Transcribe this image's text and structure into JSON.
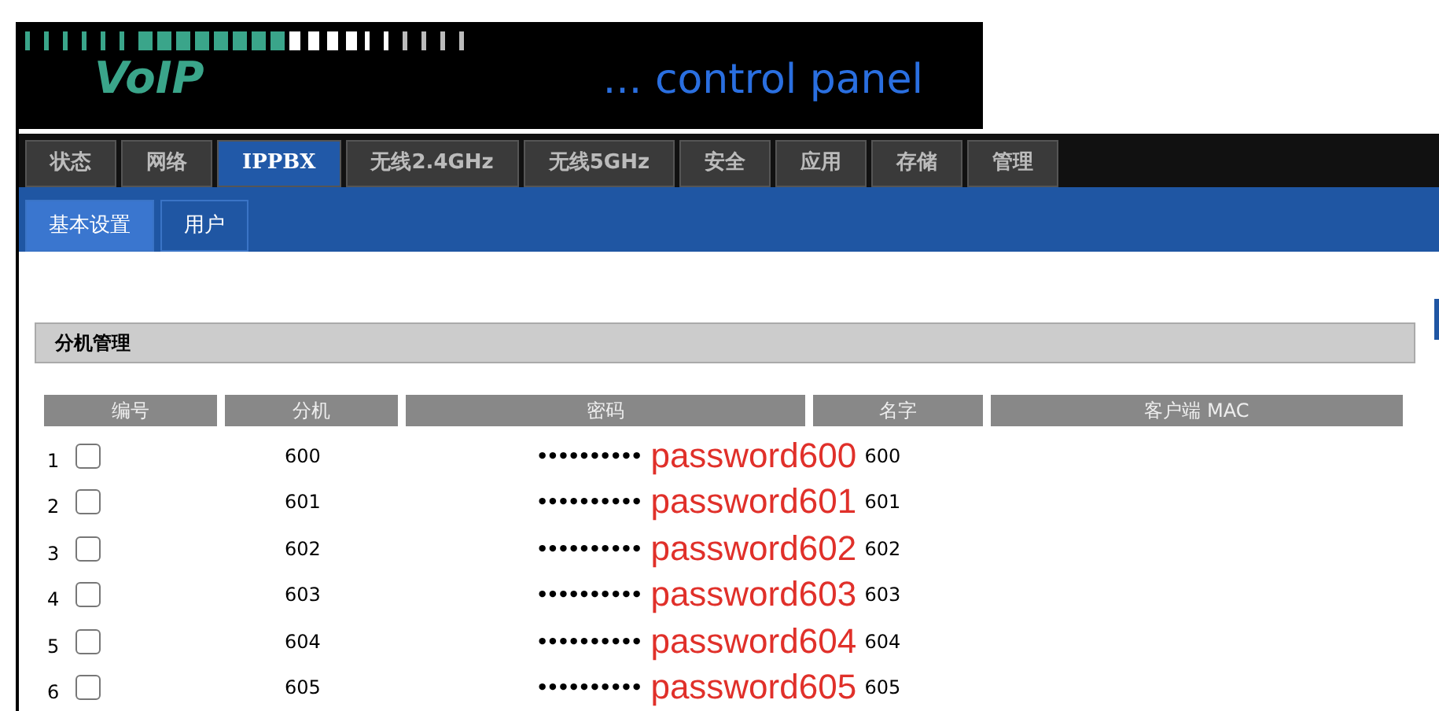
{
  "header": {
    "logo": "VoIP",
    "tagline": "... control panel"
  },
  "tabs": [
    {
      "label": "状态",
      "selected": false
    },
    {
      "label": "网络",
      "selected": false
    },
    {
      "label": "IPPBX",
      "selected": true
    },
    {
      "label": "无线2.4GHz",
      "selected": false
    },
    {
      "label": "无线5GHz",
      "selected": false
    },
    {
      "label": "安全",
      "selected": false
    },
    {
      "label": "应用",
      "selected": false
    },
    {
      "label": "存储",
      "selected": false
    },
    {
      "label": "管理",
      "selected": false
    }
  ],
  "subtabs": [
    {
      "label": "基本设置",
      "selected": true
    },
    {
      "label": "用户",
      "selected": false
    }
  ],
  "section": {
    "title": "分机管理"
  },
  "table": {
    "columns": [
      "编号",
      "分机",
      "密码",
      "名字",
      "客户端 MAC"
    ],
    "rows": [
      {
        "index": "1",
        "checked": false,
        "extension": "600",
        "password": "••••••••••",
        "note": "password600",
        "name": "600"
      },
      {
        "index": "2",
        "checked": false,
        "extension": "601",
        "password": "••••••••••",
        "note": "password601",
        "name": "601"
      },
      {
        "index": "3",
        "checked": false,
        "extension": "602",
        "password": "••••••••••",
        "note": "password602",
        "name": "602"
      },
      {
        "index": "4",
        "checked": false,
        "extension": "603",
        "password": "••••••••••",
        "note": "password603",
        "name": "603"
      },
      {
        "index": "5",
        "checked": false,
        "extension": "604",
        "password": "••••••••••",
        "note": "password604",
        "name": "604"
      },
      {
        "index": "6",
        "checked": false,
        "extension": "605",
        "password": "••••••••••",
        "note": "password605",
        "name": "605"
      }
    ]
  }
}
